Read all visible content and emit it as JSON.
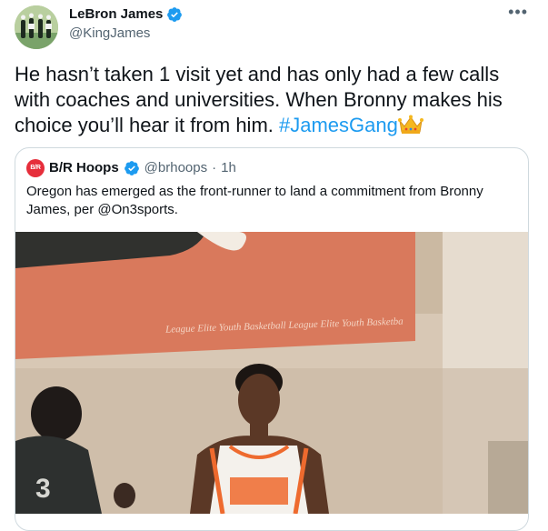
{
  "tweet": {
    "author_name": "LeBron James",
    "author_handle": "@KingJames",
    "more_icon": "more-horizontal-icon",
    "text_main": "He hasn’t taken 1 visit yet and has only had a few calls with coaches and universities. When Bronny makes his choice you’ll hear it from him. ",
    "hashtag": "#JamesGang",
    "emoji": "crown"
  },
  "quote": {
    "author_name": "B/R Hoops",
    "author_handle": "@brhoops",
    "separator": "·",
    "time": "1h",
    "text": "Oregon has emerged as the front-runner to land a commitment from Bronny James, per @On3sports.",
    "media_banner_text": "League Elite Youth Basketball League Elite Youth Basketba",
    "jersey_number": "3"
  },
  "colors": {
    "accent": "#1d9bf0",
    "verified": "#1d9bf0",
    "br_badge": "#e62e3b",
    "banner": "#d9795c",
    "jersey": "#ee6a2e"
  }
}
